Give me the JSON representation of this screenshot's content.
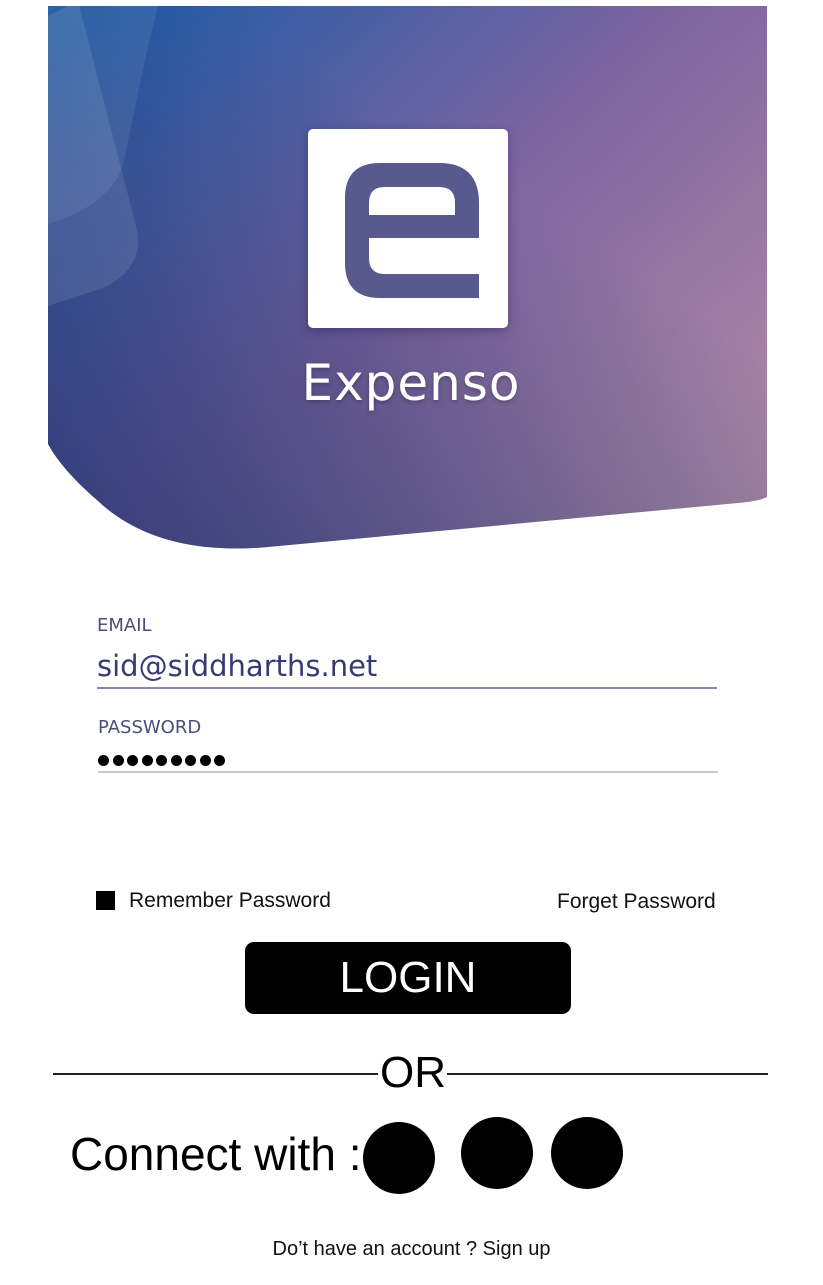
{
  "app": {
    "name": "Expenso",
    "logo_icon": "letter-e-logo-icon"
  },
  "colors": {
    "gradient_blue": "#1e5aa6",
    "gradient_purple": "#7f65a0",
    "gradient_pink": "#b08ca5",
    "logo_mark": "#585a8e",
    "field_label": "#4a4e7a",
    "email_text": "#3a3a72"
  },
  "form": {
    "email": {
      "label": "EMAIL",
      "value": "sid@siddharths.net"
    },
    "password": {
      "label": "PASSWORD",
      "masked_value": "●●●●●●●●●",
      "length": 9
    },
    "remember_label": "Remember Password",
    "forget_label": "Forget Password",
    "login_label": "LOGIN"
  },
  "divider": {
    "text": "OR"
  },
  "social": {
    "label": "Connect with :",
    "buttons": [
      {
        "icon": "social-login-icon-1"
      },
      {
        "icon": "social-login-icon-2"
      },
      {
        "icon": "social-login-icon-3"
      }
    ]
  },
  "signup": {
    "prompt": "Do’t have an account ?",
    "link": "Sign up"
  }
}
